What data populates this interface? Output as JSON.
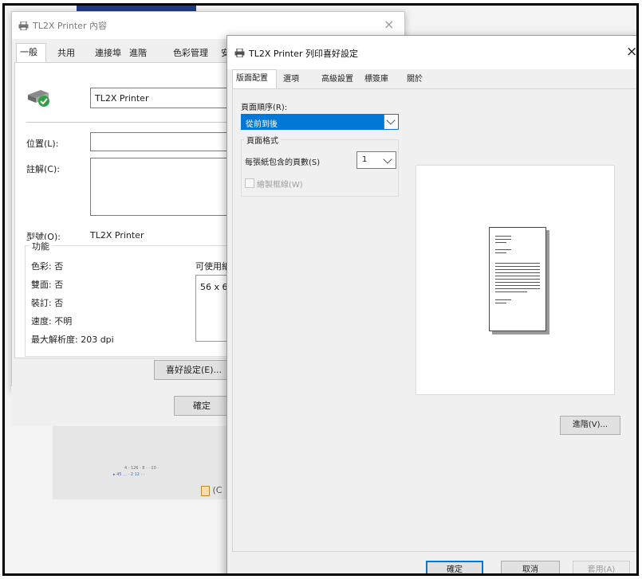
{
  "bg_dialog": {
    "title": "TL2X Printer 內容",
    "tabs": [
      "一般",
      "共用",
      "連接埠",
      "進階",
      "色彩管理",
      "安"
    ],
    "printer_name": "TL2X Printer",
    "location_label": "位置(L):",
    "comment_label": "註解(C):",
    "model_label": "型號(O):",
    "model_value": "TL2X Printer",
    "features_title": "功能",
    "features": [
      "色彩: 否",
      "雙面: 否",
      "裝訂: 否",
      "速度: 不明",
      "最大解析度: 203 dpi"
    ],
    "paper_available_label": "可使用紙",
    "paper_value": "56 x 6",
    "preferences_button": "喜好設定(E)...",
    "ok_button": "確定"
  },
  "taskbar_fragment": {
    "ruler_text": "4 · 126 · 8 ·   · 10 ·",
    "status_text": "▸ 45 …  · 2 12 ·  ·",
    "paste_label": "(C"
  },
  "fg_dialog": {
    "title": "TL2X Printer 列印喜好設定",
    "close_label": "×",
    "tabs": [
      "版面配置",
      "選項",
      "高級設置",
      "標簽庫",
      "關於"
    ],
    "page_order_label": "頁面順序(R):",
    "page_order_value": "從前到後",
    "page_format_title": "頁面格式",
    "pages_per_sheet_label": "每張紙包含的頁數(S)",
    "pages_per_sheet_value": "1",
    "draw_borders_label": "繪製框線(W)",
    "advanced_button": "進階(V)...",
    "ok_button": "確定",
    "cancel_button": "取消",
    "apply_button": "套用(A)"
  },
  "bg_close_label": "×",
  "colors": {
    "accent": "#0078d7",
    "desktop_blue": "#1f3a8a",
    "printer_green": "#2ea043"
  }
}
